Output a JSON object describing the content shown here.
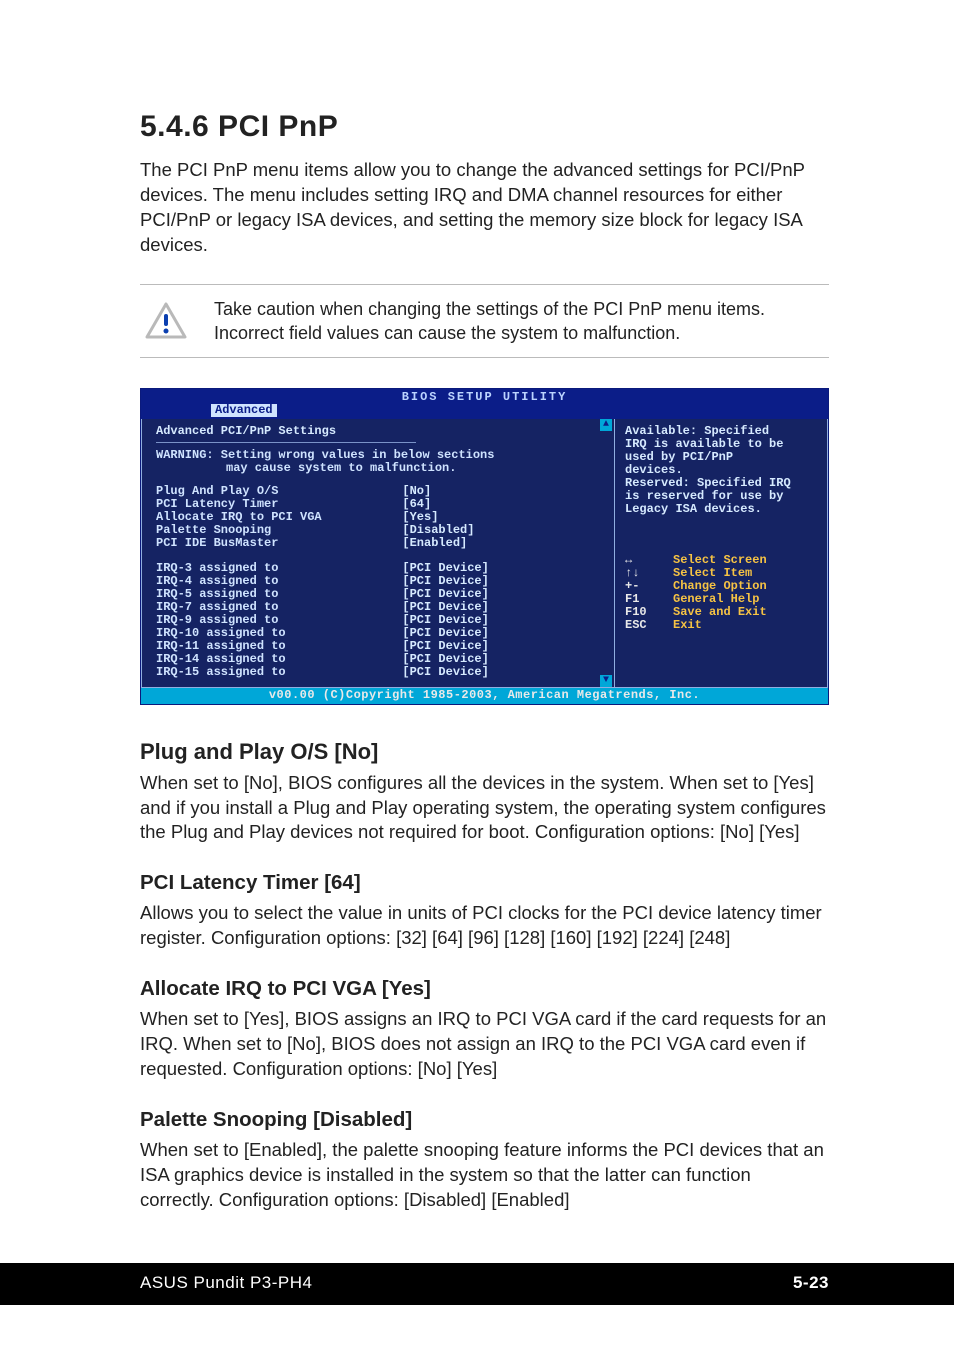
{
  "heading": "5.4.6   PCI PnP",
  "intro": "The PCI PnP menu items allow you to change the advanced settings for PCI/PnP devices. The menu includes setting IRQ and DMA channel resources for either PCI/PnP or legacy ISA devices, and setting the memory size block for legacy ISA devices.",
  "callout": "Take caution when changing the settings of the PCI PnP menu items. Incorrect field values can cause the system to malfunction.",
  "bios": {
    "title": "BIOS SETUP UTILITY",
    "tab": "Advanced",
    "panel_header": "Advanced PCI/PnP Settings",
    "warning_l1": "WARNING: Setting wrong values in below sections",
    "warning_l2": "may cause system to malfunction.",
    "group1": [
      {
        "label": "Plug And Play O/S",
        "value": "[No]"
      },
      {
        "label": "PCI Latency Timer",
        "value": "[64]"
      },
      {
        "label": "Allocate IRQ to PCI VGA",
        "value": "[Yes]"
      },
      {
        "label": "Palette Snooping",
        "value": "[Disabled]"
      },
      {
        "label": "PCI IDE BusMaster",
        "value": "[Enabled]"
      }
    ],
    "group2": [
      {
        "label": "IRQ-3 assigned to",
        "value": "[PCI Device]"
      },
      {
        "label": "IRQ-4 assigned to",
        "value": "[PCI Device]"
      },
      {
        "label": "IRQ-5 assigned to",
        "value": "[PCI Device]"
      },
      {
        "label": "IRQ-7 assigned to",
        "value": "[PCI Device]"
      },
      {
        "label": "IRQ-9 assigned to",
        "value": "[PCI Device]"
      },
      {
        "label": "IRQ-10 assigned to",
        "value": "[PCI Device]"
      },
      {
        "label": "IRQ-11 assigned to",
        "value": "[PCI Device]"
      },
      {
        "label": "IRQ-14 assigned to",
        "value": "[PCI Device]"
      },
      {
        "label": "IRQ-15 assigned to",
        "value": "[PCI Device]"
      }
    ],
    "help_l1": "Available: Specified",
    "help_l2": "IRQ is available to be",
    "help_l3": "used by PCI/PnP",
    "help_l4": "devices.",
    "help_l5": "Reserved: Specified IRQ",
    "help_l6": "is reserved for use by",
    "help_l7": "Legacy ISA devices.",
    "nav": [
      {
        "key": "↔",
        "action": "Select Screen"
      },
      {
        "key": "↑↓",
        "action": "Select Item"
      },
      {
        "key": "+-",
        "action": "Change Option"
      },
      {
        "key": "F1",
        "action": "General Help"
      },
      {
        "key": "F10",
        "action": "Save and Exit"
      },
      {
        "key": "ESC",
        "action": "Exit"
      }
    ],
    "copyright": "v00.00 (C)Copyright 1985-2003, American Megatrends, Inc."
  },
  "sections": {
    "s1_h": "Plug and Play O/S [No]",
    "s1_p": "When set to [No], BIOS configures all the devices in the system. When set to [Yes] and if you install a Plug and Play operating system, the operating system configures the Plug and Play devices not required for boot. Configuration options: [No] [Yes]",
    "s2_h": "PCI Latency Timer [64]",
    "s2_p": "Allows you to select the value in units of PCI clocks for the PCI device latency timer register. Configuration options: [32] [64] [96] [128] [160] [192] [224] [248]",
    "s3_h": "Allocate IRQ to PCI VGA [Yes]",
    "s3_p": "When set to [Yes], BIOS assigns an IRQ to PCI VGA card if the card requests for an IRQ. When set to [No], BIOS does not assign an IRQ to the PCI VGA card even if requested. Configuration options: [No] [Yes]",
    "s4_h": "Palette Snooping [Disabled]",
    "s4_p": "When set to [Enabled], the palette snooping feature informs the PCI devices that an ISA graphics device is installed in the system so that the latter can function correctly. Configuration options: [Disabled] [Enabled]"
  },
  "footer": {
    "left": "ASUS Pundit P3-PH4",
    "right": "5-23"
  }
}
